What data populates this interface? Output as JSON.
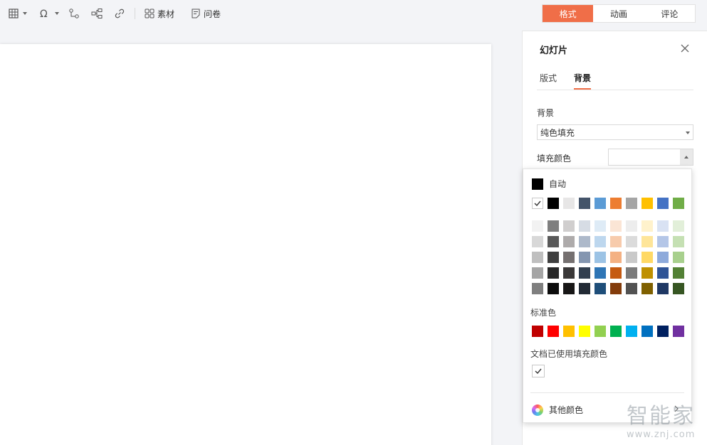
{
  "toolbar": {
    "assets_label": "素材",
    "survey_label": "问卷"
  },
  "mode_tabs": [
    "格式",
    "动画",
    "评论"
  ],
  "panel": {
    "title": "幻灯片",
    "tabs": [
      "版式",
      "背景"
    ],
    "bg_label": "背景",
    "fill_type": "纯色填充",
    "fill_color_label": "填充颜色"
  },
  "popup": {
    "auto_label": "自动",
    "theme_row": [
      "#ffffff",
      "#000000",
      "#e7e6e6",
      "#44546a",
      "#5b9bd5",
      "#ed7d31",
      "#a5a5a5",
      "#ffc000",
      "#4472c4",
      "#70ad47"
    ],
    "shades": [
      [
        "#f2f2f2",
        "#7f7f7f",
        "#d0cece",
        "#d6dce4",
        "#deebf6",
        "#fbe5d5",
        "#ededed",
        "#fff2cc",
        "#d9e2f3",
        "#e2efd9"
      ],
      [
        "#d8d8d8",
        "#595959",
        "#aeabab",
        "#adb9ca",
        "#bdd7ee",
        "#f7cbac",
        "#dbdbdb",
        "#fee599",
        "#b4c6e7",
        "#c5e0b3"
      ],
      [
        "#bfbfbf",
        "#3f3f3f",
        "#757070",
        "#8496b0",
        "#9cc3e5",
        "#f4b183",
        "#c9c9c9",
        "#ffd965",
        "#8eaadb",
        "#a8d08d"
      ],
      [
        "#a5a5a5",
        "#262626",
        "#3a3838",
        "#323f4f",
        "#2e75b5",
        "#c55a11",
        "#7b7b7b",
        "#bf9000",
        "#2f5496",
        "#538135"
      ],
      [
        "#7f7f7f",
        "#0c0c0c",
        "#171616",
        "#222a35",
        "#1e4e79",
        "#833c0b",
        "#525252",
        "#7f6000",
        "#1f3864",
        "#375623"
      ]
    ],
    "standard_label": "标准色",
    "standard_colors": [
      "#c00000",
      "#ff0000",
      "#ffc000",
      "#ffff00",
      "#92d050",
      "#00b050",
      "#00b0f0",
      "#0070c0",
      "#002060",
      "#7030a0"
    ],
    "used_label": "文档已使用填充颜色",
    "more_label": "其他颜色"
  },
  "watermark": {
    "brand": "智能家",
    "url": "www.znj.com"
  },
  "colors": {
    "accent": "#f06e48"
  }
}
